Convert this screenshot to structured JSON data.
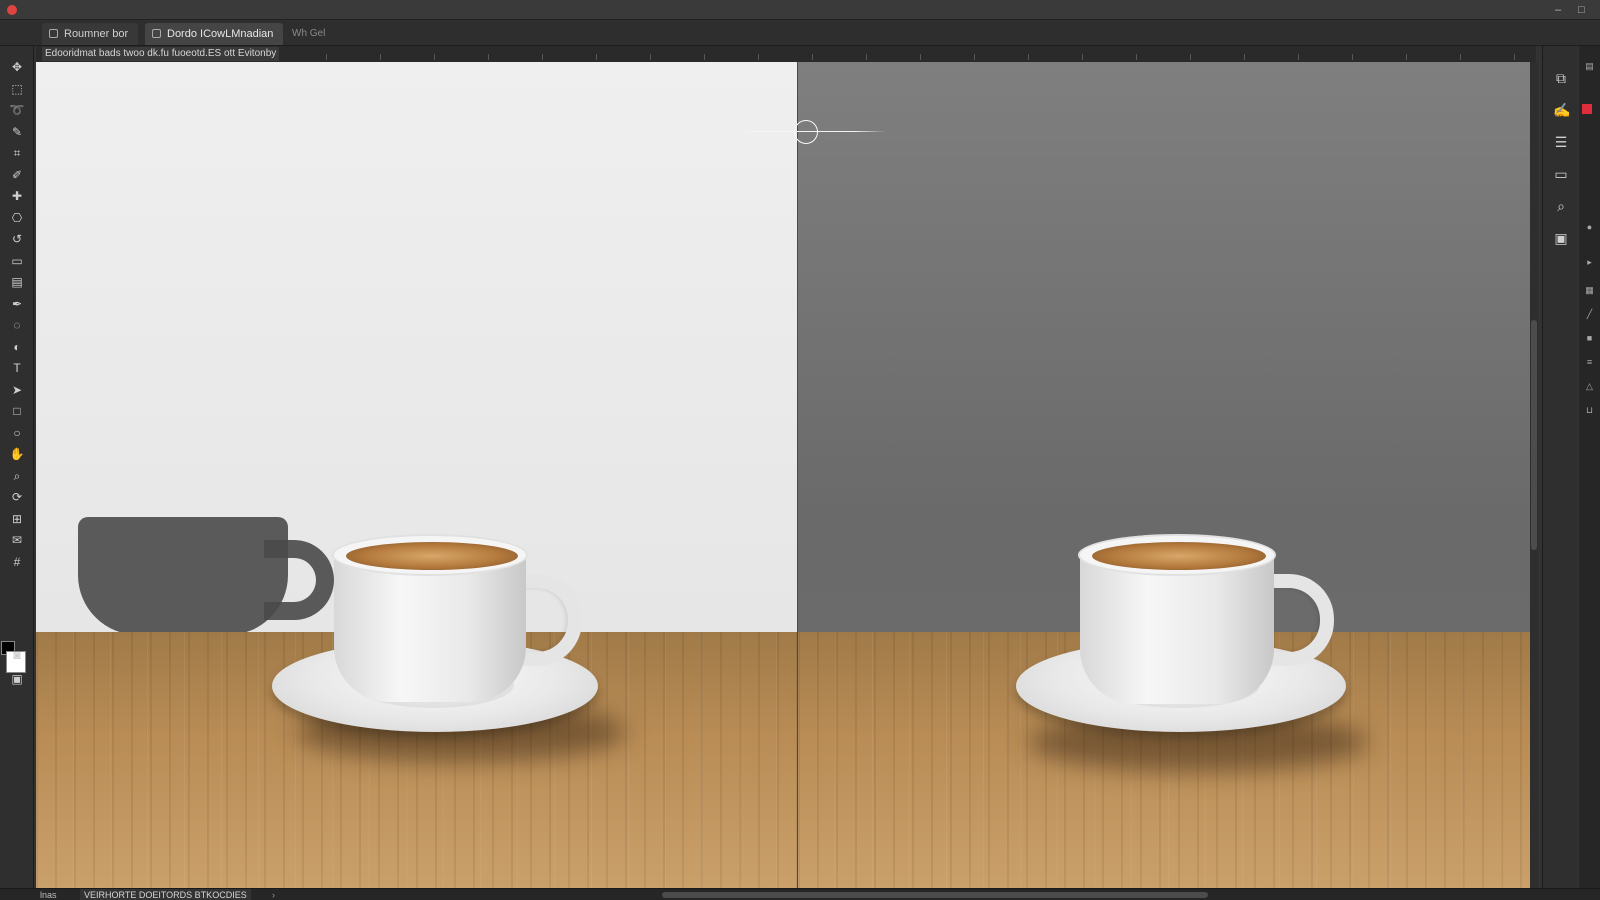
{
  "window": {
    "controls": {
      "minimize": "–",
      "maximize": "□"
    }
  },
  "tabs": [
    {
      "label": "Roumner bor",
      "active": false
    },
    {
      "label": "Dordo ICowLMnadian",
      "active": true
    }
  ],
  "tab_extra": "Wh Gel",
  "infobar": {
    "doc_info": "Edooridmat bads twoo dk.fu fuoeotd.ES ott Evitonby"
  },
  "toolbar": {
    "tools": [
      "move-icon",
      "marquee-icon",
      "lasso-icon",
      "brush-icon",
      "crop-icon",
      "eyedropper-icon",
      "healing-icon",
      "clone-stamp-icon",
      "history-brush-icon",
      "eraser-icon",
      "gradient-icon",
      "pen-icon",
      "blur-icon",
      "dodge-icon",
      "type-icon",
      "path-select-icon",
      "shape-icon",
      "ellipse-icon",
      "hand-icon",
      "zoom-icon",
      "rotate-icon",
      "frame-icon",
      "note-icon",
      "count-icon",
      "quick-mask-icon",
      "screen-mode-icon"
    ],
    "foreground_color": "#000000",
    "background_color": "#ffffff"
  },
  "right_panel": {
    "icons": [
      "layers-icon",
      "brush-settings-icon",
      "channels-icon",
      "adjustments-icon",
      "search-icon",
      "properties-icon"
    ]
  },
  "statusbar": {
    "zoom": "lnas",
    "doc_label": "VEIRHORTE DOEITORDS BTKOCDIES",
    "arrow": "›"
  },
  "colors": {
    "accent_red": "#e02d3d",
    "left_background": "#ececec",
    "right_background": "#777777",
    "table_wood": "#b98c55"
  }
}
